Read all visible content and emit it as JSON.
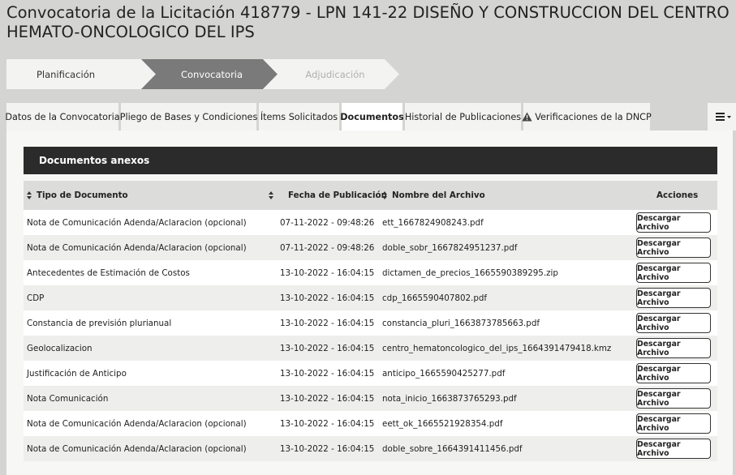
{
  "page": {
    "title": "Convocatoria de la Licitación 418779 - LPN 141-22 DISEÑO Y CONSTRUCCION DEL CENTRO HEMATO-ONCOLOGICO DEL IPS"
  },
  "stepper": {
    "steps": [
      {
        "label": "Planificación",
        "state": "completed"
      },
      {
        "label": "Convocatoria",
        "state": "current"
      },
      {
        "label": "Adjudicación",
        "state": "pending"
      }
    ]
  },
  "tabs": [
    {
      "label": "Datos de la Convocatoria"
    },
    {
      "label": "Pliego de Bases y Condiciones"
    },
    {
      "label": "Ítems Solicitados"
    },
    {
      "label": "Documentos",
      "active": true
    },
    {
      "label": "Historial de Publicaciones"
    },
    {
      "label": "Verificaciones de la DNCP",
      "icon": "warning-icon"
    }
  ],
  "menu_icon": "hamburger-dropdown-icon",
  "section": {
    "title": "Documentos anexos"
  },
  "table": {
    "headers": {
      "tipo": "Tipo de Documento",
      "fecha": "Fecha de Publicación",
      "nombre": "Nombre del Archivo",
      "acciones": "Acciones"
    },
    "action_label": "Descargar Archivo",
    "rows": [
      {
        "tipo": "Nota de Comunicación Adenda/Aclaracion (opcional)",
        "fecha": "07-11-2022 - 09:48:26",
        "nombre": "ett_1667824908243.pdf"
      },
      {
        "tipo": "Nota de Comunicación Adenda/Aclaracion (opcional)",
        "fecha": "07-11-2022 - 09:48:26",
        "nombre": "doble_sobr_1667824951237.pdf"
      },
      {
        "tipo": "Antecedentes de Estimación de Costos",
        "fecha": "13-10-2022 - 16:04:15",
        "nombre": "dictamen_de_precios_1665590389295.zip"
      },
      {
        "tipo": "CDP",
        "fecha": "13-10-2022 - 16:04:15",
        "nombre": "cdp_1665590407802.pdf"
      },
      {
        "tipo": "Constancia de previsión plurianual",
        "fecha": "13-10-2022 - 16:04:15",
        "nombre": "constancia_pluri_1663873785663.pdf"
      },
      {
        "tipo": "Geolocalizacion",
        "fecha": "13-10-2022 - 16:04:15",
        "nombre": "centro_hematoncologico_del_ips_1664391479418.kmz"
      },
      {
        "tipo": "Justificación de Anticipo",
        "fecha": "13-10-2022 - 16:04:15",
        "nombre": "anticipo_1665590425277.pdf"
      },
      {
        "tipo": "Nota Comunicación",
        "fecha": "13-10-2022 - 16:04:15",
        "nombre": "nota_inicio_1663873765293.pdf"
      },
      {
        "tipo": "Nota de Comunicación Adenda/Aclaracion (opcional)",
        "fecha": "13-10-2022 - 16:04:15",
        "nombre": "eett_ok_1665521928354.pdf"
      },
      {
        "tipo": "Nota de Comunicación Adenda/Aclaracion (opcional)",
        "fecha": "13-10-2022 - 16:04:15",
        "nombre": "doble_sobre_1664391411456.pdf"
      }
    ]
  },
  "colors": {
    "background": "#d4d4d2",
    "section_header": "#2c2b2b",
    "active_step": "#7a7a7a",
    "table_header": "#dcdcdb"
  }
}
